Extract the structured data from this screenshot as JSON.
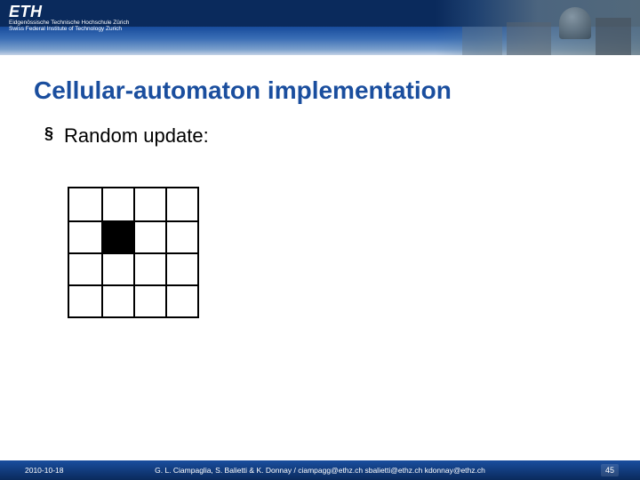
{
  "header": {
    "logo_text": "ETH",
    "subline1": "Eidgenössische Technische Hochschule Zürich",
    "subline2": "Swiss Federal Institute of Technology Zurich"
  },
  "title": "Cellular-automaton implementation",
  "bullet": {
    "marker": "§",
    "text": "Random update:"
  },
  "grid": {
    "rows": 4,
    "cols": 4,
    "filled": [
      [
        1,
        1
      ]
    ]
  },
  "footer": {
    "date": "2010-10-18",
    "credits": "G. L. Ciampaglia, S. Balietti & K. Donnay /  ciampagg@ethz.ch  sbalietti@ethz.ch  kdonnay@ethz.ch",
    "page": "45"
  }
}
